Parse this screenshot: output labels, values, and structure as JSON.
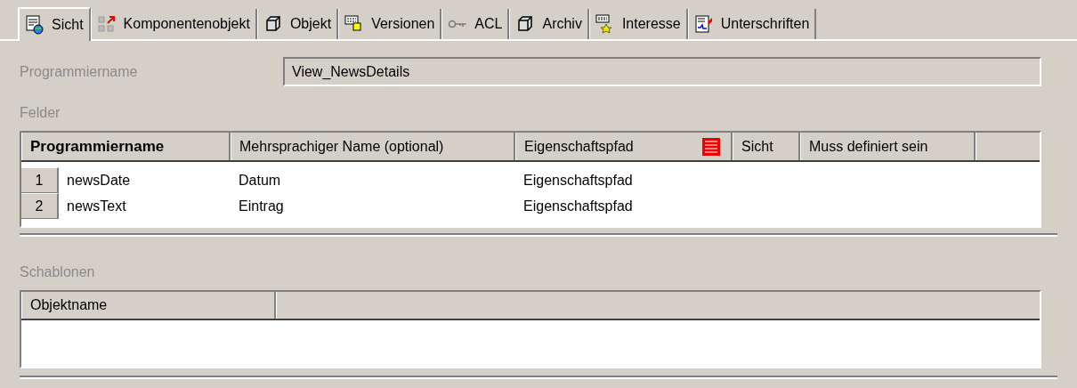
{
  "tabs": [
    {
      "label": "Sicht",
      "selected": true,
      "kind": "view"
    },
    {
      "label": "Komponentenobjekt",
      "selected": false,
      "kind": "component"
    },
    {
      "label": "Objekt",
      "selected": false,
      "kind": "cube"
    },
    {
      "label": "Versionen",
      "selected": false,
      "kind": "versions"
    },
    {
      "label": "ACL",
      "selected": false,
      "kind": "key"
    },
    {
      "label": "Archiv",
      "selected": false,
      "kind": "cube"
    },
    {
      "label": "Interesse",
      "selected": false,
      "kind": "star"
    },
    {
      "label": "Unterschriften",
      "selected": false,
      "kind": "signature"
    }
  ],
  "program_name": {
    "label": "Programmiername",
    "value": "View_NewsDetails"
  },
  "fields": {
    "label": "Felder",
    "columns": [
      {
        "label": "Programmiername",
        "bold": true
      },
      {
        "label": "Mehrsprachiger Name (optional)",
        "bold": false
      },
      {
        "label": "Eigenschaftspfad",
        "bold": false,
        "icon": true
      },
      {
        "label": "Sicht",
        "bold": false
      },
      {
        "label": "Muss definiert sein",
        "bold": false
      }
    ],
    "rows": [
      {
        "number": "1",
        "cells": [
          "newsDate",
          "Datum",
          "Eigenschaftspfad"
        ]
      },
      {
        "number": "2",
        "cells": [
          "newsText",
          "Eintrag",
          "Eigenschaftspfad"
        ]
      }
    ]
  },
  "templates": {
    "label": "Schablonen",
    "columns": [
      "Objektname"
    ]
  }
}
